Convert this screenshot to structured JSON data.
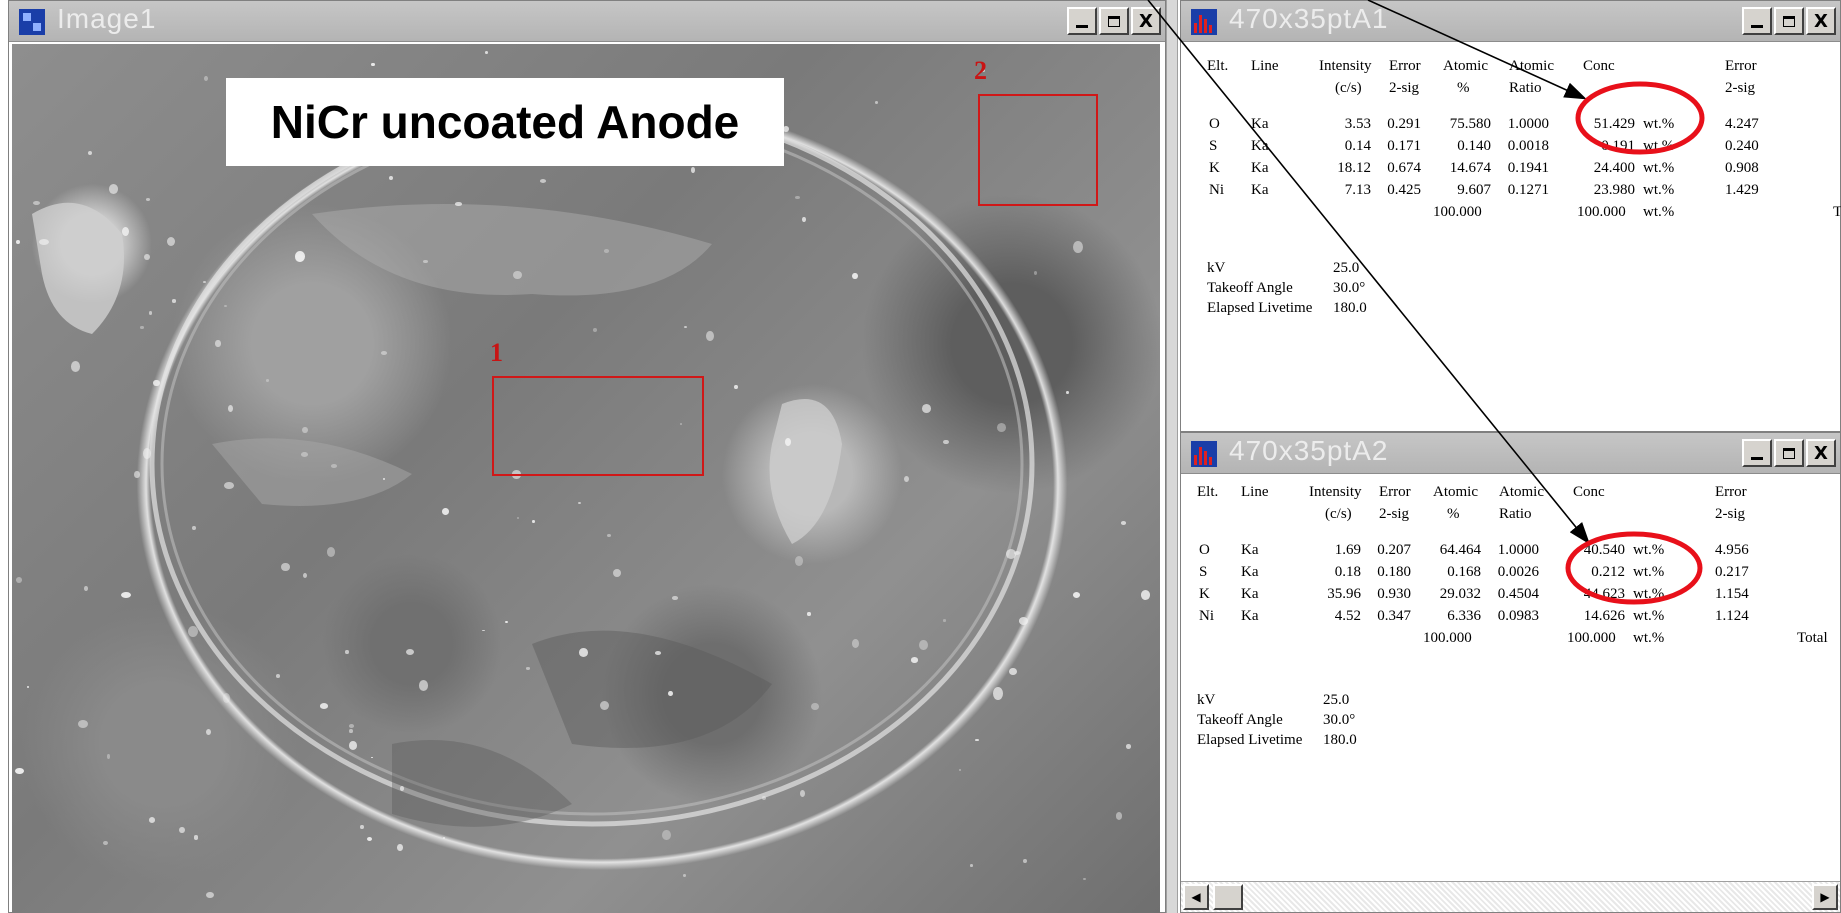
{
  "image_window": {
    "title": "Image1",
    "banner": "NiCr uncoated Anode",
    "roi_labels": [
      "1",
      "2"
    ]
  },
  "spectrum_windows": [
    {
      "title": "470x35ptA1",
      "headers": [
        "Elt.",
        "Line",
        "Intensity (c/s)",
        "Error 2-sig",
        "Atomic %",
        "Atomic Ratio",
        "Conc",
        "",
        "Error 2-sig"
      ],
      "header_line1": [
        "Elt.",
        "Line",
        "Intensity",
        "Error",
        "Atomic",
        "Atomic",
        "Conc",
        "Error"
      ],
      "header_line2": [
        "",
        "",
        "(c/s)",
        "2-sig",
        "%",
        "Ratio",
        "",
        "2-sig"
      ],
      "rows": [
        [
          "O",
          "Ka",
          "3.53",
          "0.291",
          "75.580",
          "1.0000",
          "51.429",
          "wt.%",
          "4.247"
        ],
        [
          "S",
          "Ka",
          "0.14",
          "0.171",
          "0.140",
          "0.0018",
          "0.191",
          "wt.%",
          "0.240"
        ],
        [
          "K",
          "Ka",
          "18.12",
          "0.674",
          "14.674",
          "0.1941",
          "24.400",
          "wt.%",
          "0.908"
        ],
        [
          "Ni",
          "Ka",
          "7.13",
          "0.425",
          "9.607",
          "0.1271",
          "23.980",
          "wt.%",
          "1.429"
        ]
      ],
      "totals": {
        "atomic": "100.000",
        "conc": "100.000",
        "unit": "wt.%",
        "label": "Total"
      },
      "params": [
        {
          "label": "kV",
          "value": "25.0"
        },
        {
          "label": "Takeoff Angle",
          "value": "30.0°"
        },
        {
          "label": "Elapsed Livetime",
          "value": "180.0"
        }
      ]
    },
    {
      "title": "470x35ptA2",
      "header_line1": [
        "Elt.",
        "Line",
        "Intensity",
        "Error",
        "Atomic",
        "Atomic",
        "Conc",
        "Error"
      ],
      "header_line2": [
        "",
        "",
        "(c/s)",
        "2-sig",
        "%",
        "Ratio",
        "",
        "2-sig"
      ],
      "rows": [
        [
          "O",
          "Ka",
          "1.69",
          "0.207",
          "64.464",
          "1.0000",
          "40.540",
          "wt.%",
          "4.956"
        ],
        [
          "S",
          "Ka",
          "0.18",
          "0.180",
          "0.168",
          "0.0026",
          "0.212",
          "wt.%",
          "0.217"
        ],
        [
          "K",
          "Ka",
          "35.96",
          "0.930",
          "29.032",
          "0.4504",
          "44.623",
          "wt.%",
          "1.154"
        ],
        [
          "Ni",
          "Ka",
          "4.52",
          "0.347",
          "6.336",
          "0.0983",
          "14.626",
          "wt.%",
          "1.124"
        ]
      ],
      "totals": {
        "atomic": "100.000",
        "conc": "100.000",
        "unit": "wt.%",
        "label": "Total"
      },
      "params": [
        {
          "label": "kV",
          "value": "25.0"
        },
        {
          "label": "Takeoff Angle",
          "value": "30.0°"
        },
        {
          "label": "Elapsed Livetime",
          "value": "180.0"
        }
      ]
    }
  ],
  "window_buttons": {
    "minimize": "_",
    "maximize": "□",
    "close": "X"
  },
  "icons": {
    "image_window": "grid-app-icon",
    "spectrum_window": "spectrum-app-icon",
    "scroll_left": "arrow-left-icon",
    "scroll_right": "arrow-right-icon"
  },
  "colors": {
    "highlight": "#e8101a",
    "roi": "#d01818",
    "title_text": "#ececec"
  }
}
